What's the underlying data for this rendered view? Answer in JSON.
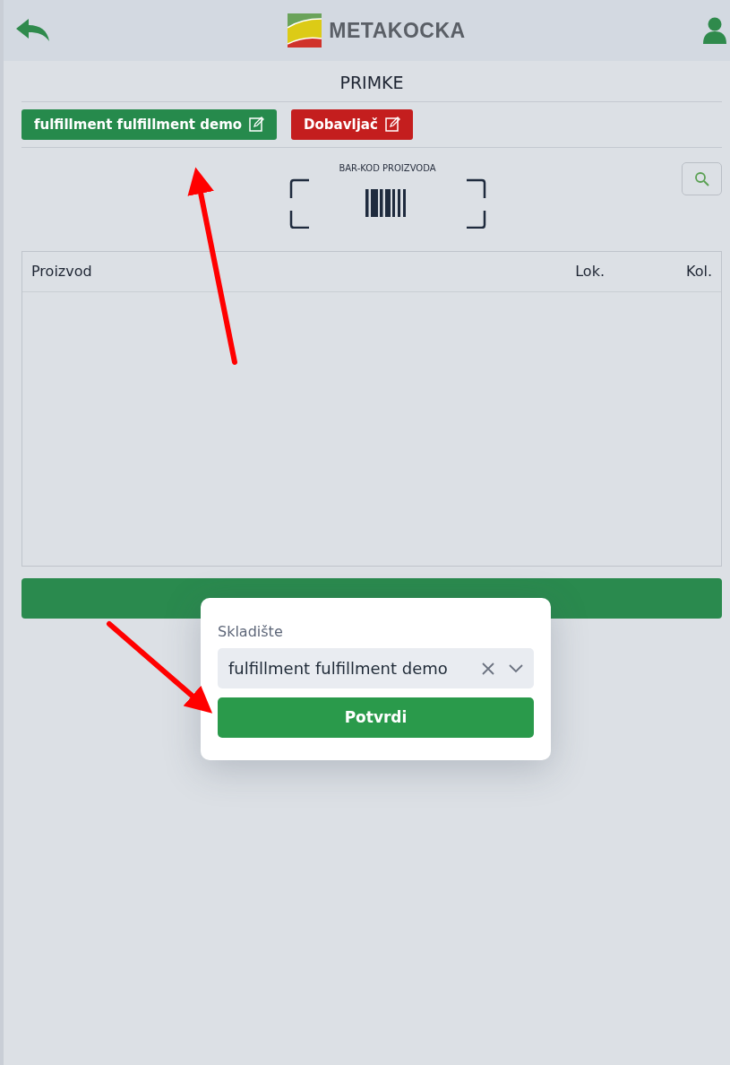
{
  "header": {
    "logo_text": "METAKOCKA"
  },
  "page_title": "PRIMKE",
  "chips": [
    {
      "label": "fulfillment fulfillment demo",
      "kind": "success"
    },
    {
      "label": "Dobavljač",
      "kind": "danger"
    }
  ],
  "scanner": {
    "label": "BAR-KOD PROIZVODA"
  },
  "table": {
    "columns": [
      "Proizvod",
      "Lok.",
      "Kol."
    ]
  },
  "modal": {
    "label": "Skladište",
    "value": "fulfillment fulfillment demo",
    "button": "Potvrdi"
  }
}
